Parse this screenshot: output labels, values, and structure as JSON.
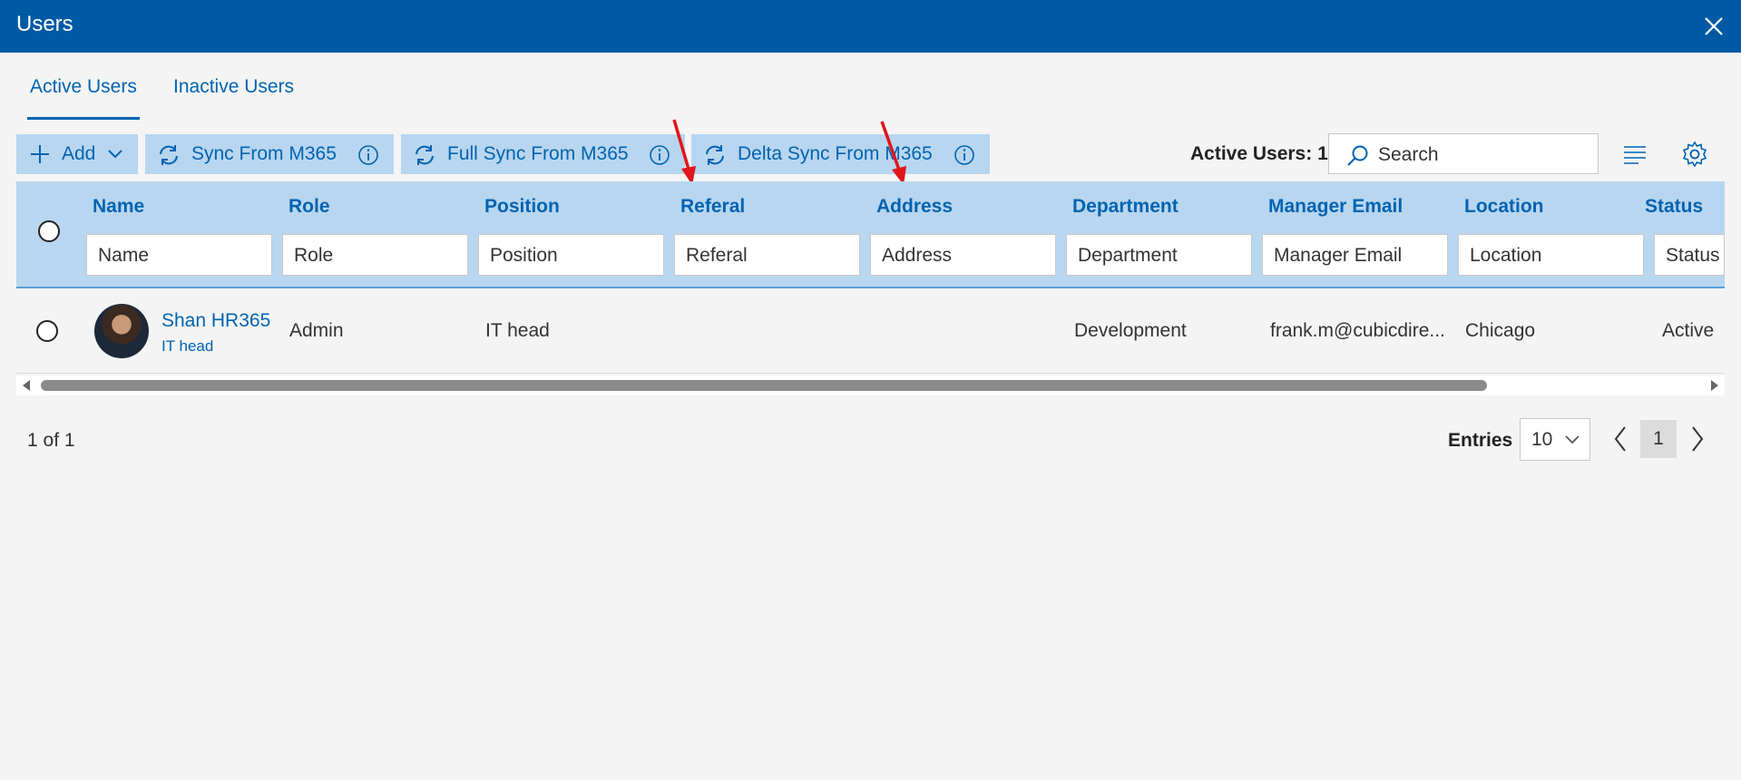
{
  "window": {
    "title": "Users"
  },
  "tabs": [
    {
      "label": "Active Users"
    },
    {
      "label": "Inactive Users"
    }
  ],
  "toolbar": {
    "add_label": "Add",
    "sync_label": "Sync From M365",
    "full_sync_label": "Full Sync From M365",
    "delta_sync_label": "Delta Sync From M365",
    "active_users_label": "Active Users: 1",
    "search_placeholder": "Search"
  },
  "columns": [
    {
      "header": "Name",
      "filter_placeholder": "Name"
    },
    {
      "header": "Role",
      "filter_placeholder": "Role"
    },
    {
      "header": "Position",
      "filter_placeholder": "Position"
    },
    {
      "header": "Referal",
      "filter_placeholder": "Referal"
    },
    {
      "header": "Address",
      "filter_placeholder": "Address"
    },
    {
      "header": "Department",
      "filter_placeholder": "Department"
    },
    {
      "header": "Manager Email",
      "filter_placeholder": "Manager Email"
    },
    {
      "header": "Location",
      "filter_placeholder": "Location"
    },
    {
      "header": "Status",
      "filter_placeholder": "Status"
    }
  ],
  "rows": [
    {
      "name": "Shan HR365",
      "subtitle": "IT head",
      "role": "Admin",
      "position": "IT head",
      "referal": "",
      "address": "",
      "department": "Development",
      "manager_email": "frank.m@cubicdire...",
      "location": "Chicago",
      "status": "Active"
    }
  ],
  "footer": {
    "page_info": "1 of 1",
    "entries_label": "Entries",
    "entries_value": "10",
    "current_page": "1"
  },
  "colors": {
    "accent": "#005aa3",
    "link": "#0063b1",
    "header_bg": "#b8d6ef",
    "annotation_arrow": "#e0161b"
  },
  "icons": [
    "close-icon",
    "plus-icon",
    "chevron-down-icon",
    "sync-icon",
    "info-icon",
    "search-icon",
    "text-align-icon",
    "gear-icon",
    "chevron-left-icon",
    "chevron-right-icon"
  ]
}
